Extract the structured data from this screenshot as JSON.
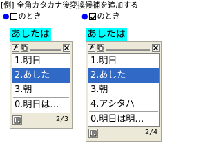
{
  "title": "[例] 全角カタカナ後変換候補を追加する",
  "left": {
    "option_label": "のとき",
    "checked": false,
    "preedit": "あしたは",
    "candidates": [
      "1.明日",
      "2.あした",
      "3.朝",
      "0.明日は…"
    ],
    "selected_index": 1,
    "page": "2/3"
  },
  "right": {
    "option_label": "のとき",
    "checked": true,
    "preedit": "あしたは",
    "candidates": [
      "1.明日",
      "2.あした",
      "3.朝",
      "4.アシタハ",
      "0.明日は明…"
    ],
    "selected_index": 1,
    "page": "2/4"
  },
  "icons": {
    "bullet": "bullet-icon",
    "pin": "pin-icon",
    "copy": "copy-icon",
    "close": "close-icon",
    "dictionary": "dictionary-icon"
  },
  "colors": {
    "highlight": "#3169c6",
    "preedit_bg": "#00ffff",
    "bullet": "#0000ff"
  }
}
